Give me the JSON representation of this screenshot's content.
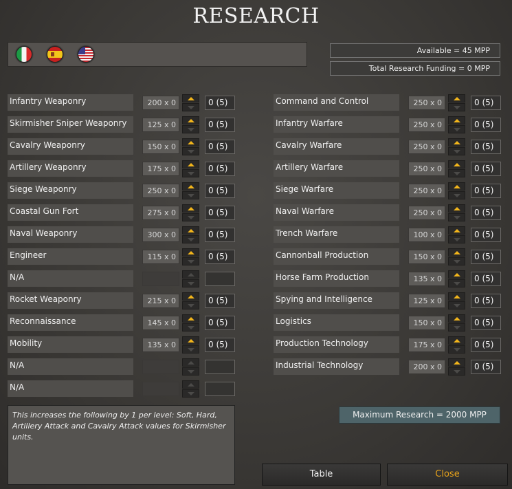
{
  "title": "RESEARCH",
  "flags": [
    "italy-flag-icon",
    "spain-flag-icon",
    "usa-flag-icon"
  ],
  "available": "Available = 45 MPP",
  "funding": "Total Research Funding = 0 MPP",
  "left_rows": [
    {
      "label": "Infantry Weaponry",
      "cost": "200 x 0",
      "level": "0 (5)"
    },
    {
      "label": "Skirmisher Sniper Weaponry",
      "cost": "125 x 0",
      "level": "0 (5)"
    },
    {
      "label": "Cavalry Weaponry",
      "cost": "150 x 0",
      "level": "0 (5)"
    },
    {
      "label": "Artillery Weaponry",
      "cost": "175 x 0",
      "level": "0 (5)"
    },
    {
      "label": "Siege Weaponry",
      "cost": "250 x 0",
      "level": "0 (5)"
    },
    {
      "label": "Coastal Gun Fort",
      "cost": "275 x 0",
      "level": "0 (5)"
    },
    {
      "label": "Naval Weaponry",
      "cost": "300 x 0",
      "level": "0 (5)"
    },
    {
      "label": "Engineer",
      "cost": "115 x 0",
      "level": "0 (5)"
    },
    {
      "label": "N/A",
      "cost": "",
      "level": ""
    },
    {
      "label": "Rocket Weaponry",
      "cost": "215 x 0",
      "level": "0 (5)"
    },
    {
      "label": "Reconnaissance",
      "cost": "145 x 0",
      "level": "0 (5)"
    },
    {
      "label": "Mobility",
      "cost": "135 x 0",
      "level": "0 (5)"
    },
    {
      "label": "N/A",
      "cost": "",
      "level": ""
    },
    {
      "label": "N/A",
      "cost": "",
      "level": ""
    }
  ],
  "right_rows": [
    {
      "label": "Command and Control",
      "cost": "250 x 0",
      "level": "0 (5)"
    },
    {
      "label": "Infantry Warfare",
      "cost": "250 x 0",
      "level": "0 (5)"
    },
    {
      "label": "Cavalry Warfare",
      "cost": "250 x 0",
      "level": "0 (5)"
    },
    {
      "label": "Artillery Warfare",
      "cost": "250 x 0",
      "level": "0 (5)"
    },
    {
      "label": "Siege Warfare",
      "cost": "250 x 0",
      "level": "0 (5)"
    },
    {
      "label": "Naval Warfare",
      "cost": "250 x 0",
      "level": "0 (5)"
    },
    {
      "label": "Trench Warfare",
      "cost": "100 x 0",
      "level": "0 (5)"
    },
    {
      "label": "Cannonball Production",
      "cost": "150 x 0",
      "level": "0 (5)"
    },
    {
      "label": "Horse Farm Production",
      "cost": "135 x 0",
      "level": "0 (5)"
    },
    {
      "label": "Spying and Intelligence",
      "cost": "125 x 0",
      "level": "0 (5)"
    },
    {
      "label": "Logistics",
      "cost": "150 x 0",
      "level": "0 (5)"
    },
    {
      "label": "Production Technology",
      "cost": "175 x 0",
      "level": "0 (5)"
    },
    {
      "label": "Industrial Technology",
      "cost": "200 x 0",
      "level": "0 (5)"
    }
  ],
  "description": "This increases the following by 1 per level: Soft, Hard, Artillery Attack and Cavalry Attack values for Skirmisher units.",
  "max_research": "Maximum Research =  2000 MPP",
  "buttons": {
    "table": "Table",
    "close": "Close"
  },
  "colors": {
    "accent": "#f2b51b",
    "close_text": "#e8a31a",
    "max_box": "#4e6469"
  }
}
